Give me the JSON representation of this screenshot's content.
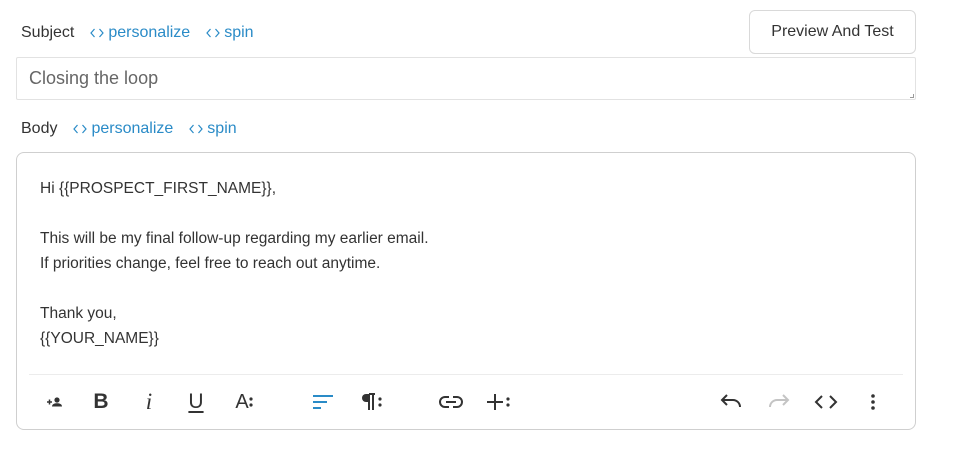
{
  "subject": {
    "label": "Subject",
    "personalize_label": "personalize",
    "spin_label": "spin",
    "value": "Closing the loop"
  },
  "preview_button_label": "Preview And Test",
  "body": {
    "label": "Body",
    "personalize_label": "personalize",
    "spin_label": "spin",
    "lines": [
      "Hi {{PROSPECT_FIRST_NAME}},",
      "",
      "This will be my final follow-up regarding my earlier email.",
      "If priorities change, feel free to reach out anytime.",
      "",
      "Thank you,",
      "{{YOUR_NAME}}"
    ]
  },
  "toolbar": {
    "icons": [
      "person-add-icon",
      "bold-icon",
      "italic-icon",
      "underline-icon",
      "text-format-icon",
      "align-left-icon",
      "paragraph-icon",
      "link-icon",
      "insert-icon",
      "undo-icon",
      "redo-icon",
      "code-icon",
      "more-vertical-icon"
    ],
    "bold_glyph": "B",
    "italic_glyph": "i",
    "underline_glyph": "U",
    "text_format_glyph": "A",
    "active_color": "#2a8bc7",
    "icon_color": "#333333",
    "disabled_color": "#c4c4c4"
  },
  "colors": {
    "link": "#2a8bc7",
    "border": "#cfcfcf"
  }
}
